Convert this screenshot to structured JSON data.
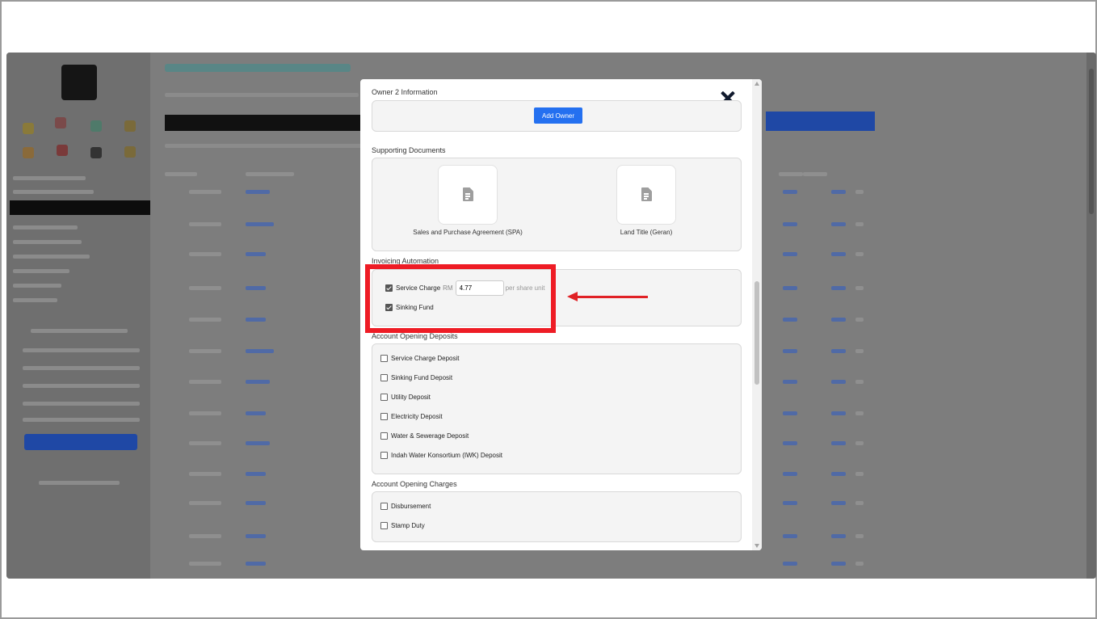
{
  "modal": {
    "owner2": {
      "section_label": "Owner 2 Information",
      "add_owner_label": "Add Owner"
    },
    "supporting_documents": {
      "section_label": "Supporting Documents",
      "items": [
        {
          "label": "Sales and Purchase Agreement (SPA)",
          "icon": "document-icon"
        },
        {
          "label": "Land Title (Geran)",
          "icon": "document-icon"
        }
      ]
    },
    "invoicing": {
      "section_label": "Invoicing Automation",
      "service_charge": {
        "label": "Service Charge",
        "currency": "RM",
        "value": "4.77",
        "unit": "per share unit",
        "checked": true
      },
      "sinking_fund": {
        "label": "Sinking Fund",
        "checked": true
      }
    },
    "deposits": {
      "section_label": "Account Opening Deposits",
      "items": [
        {
          "label": "Service Charge Deposit",
          "checked": false
        },
        {
          "label": "Sinking Fund Deposit",
          "checked": false
        },
        {
          "label": "Utility Deposit",
          "checked": false
        },
        {
          "label": "Electricity Deposit",
          "checked": false
        },
        {
          "label": "Water & Sewerage Deposit",
          "checked": false
        },
        {
          "label": "Indah Water Konsortium (IWK) Deposit",
          "checked": false
        }
      ]
    },
    "charges": {
      "section_label": "Account Opening Charges",
      "items": [
        {
          "label": "Disbursement",
          "checked": false
        },
        {
          "label": "Stamp Duty",
          "checked": false
        }
      ]
    }
  },
  "colors": {
    "highlight": "#ee1c25",
    "primary_button": "#2470f0",
    "overlay": "#7d7d7d"
  }
}
